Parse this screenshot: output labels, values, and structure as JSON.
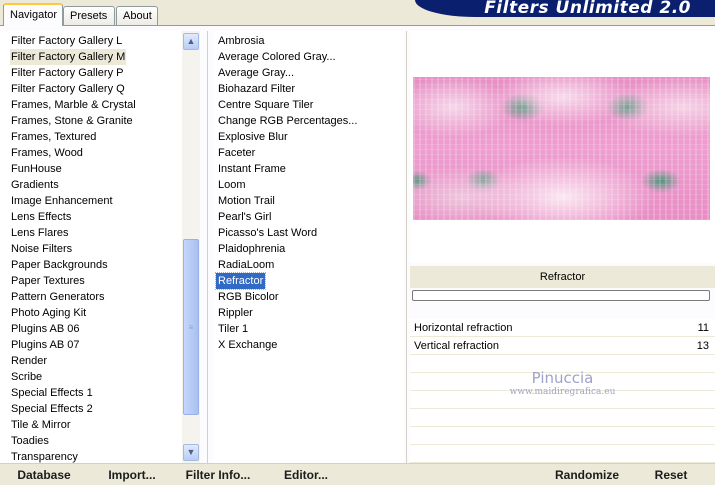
{
  "tabs": [
    "Navigator",
    "Presets",
    "About"
  ],
  "banner_title": "Filters Unlimited 2.0",
  "categories": [
    "Filter Factory Gallery L",
    "Filter Factory Gallery M",
    "Filter Factory Gallery P",
    "Filter Factory Gallery Q",
    "Frames, Marble & Crystal",
    "Frames, Stone & Granite",
    "Frames, Textured",
    "Frames, Wood",
    "FunHouse",
    "Gradients",
    "Image Enhancement",
    "Lens Effects",
    "Lens Flares",
    "Noise Filters",
    "Paper Backgrounds",
    "Paper Textures",
    "Pattern Generators",
    "Photo Aging Kit",
    "Plugins AB 06",
    "Plugins AB 07",
    "Render",
    "Scribe",
    "Special Effects 1",
    "Special Effects 2",
    "Tile & Mirror",
    "Toadies",
    "Transparency"
  ],
  "selected_category": "Filter Factory Gallery M",
  "filters": [
    "Ambrosia",
    "Average Colored Gray...",
    "Average Gray...",
    "Biohazard Filter",
    "Centre Square Tiler",
    "Change RGB Percentages...",
    "Explosive Blur",
    "Faceter",
    "Instant Frame",
    "Loom",
    "Motion Trail",
    "Pearl's Girl",
    "Picasso's Last Word",
    "Plaidophrenia",
    "RadiaLoom",
    "Refractor",
    "RGB Bicolor",
    "Rippler",
    "Tiler 1",
    "X Exchange"
  ],
  "selected_filter": "Refractor",
  "current_filter_name": "Refractor",
  "progress_fraction": 0,
  "params": [
    {
      "label": "Horizontal refraction",
      "value": "11"
    },
    {
      "label": "Vertical refraction",
      "value": "13"
    }
  ],
  "watermark": {
    "name": "Pinuccia",
    "site": "www.maidiregrafica.eu"
  },
  "bottom_buttons": [
    "Database",
    "Import...",
    "Filter Info...",
    "Editor...",
    "Randomize",
    "Reset"
  ],
  "scroll_arrows": {
    "up": "▲",
    "down": "▼",
    "grip": "≡"
  }
}
